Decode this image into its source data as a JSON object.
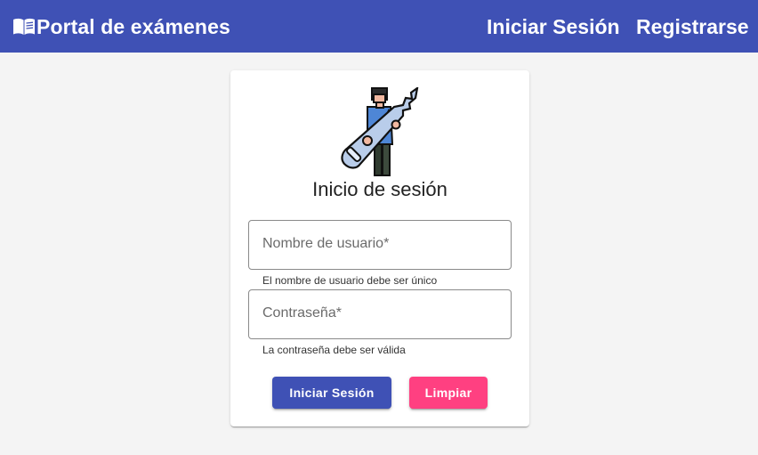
{
  "header": {
    "brand_title": "Portal de exámenes",
    "login_link": "Iniciar Sesión",
    "register_link": "Registrarse"
  },
  "login_card": {
    "title": "Inicio de sesión",
    "username_field": {
      "label": "Nombre de usuario*",
      "value": "",
      "hint": "El nombre de usuario debe ser único"
    },
    "password_field": {
      "label": "Contraseña*",
      "value": "",
      "hint": "La contraseña debe ser válida"
    },
    "login_button": "Iniciar Sesión",
    "clear_button": "Limpiar"
  },
  "colors": {
    "primary": "#3f51b5",
    "accent": "#ff4081",
    "background": "#f4f4f4"
  },
  "icons": {
    "brand": "book-open-icon",
    "illustration": "person-with-key-icon"
  }
}
